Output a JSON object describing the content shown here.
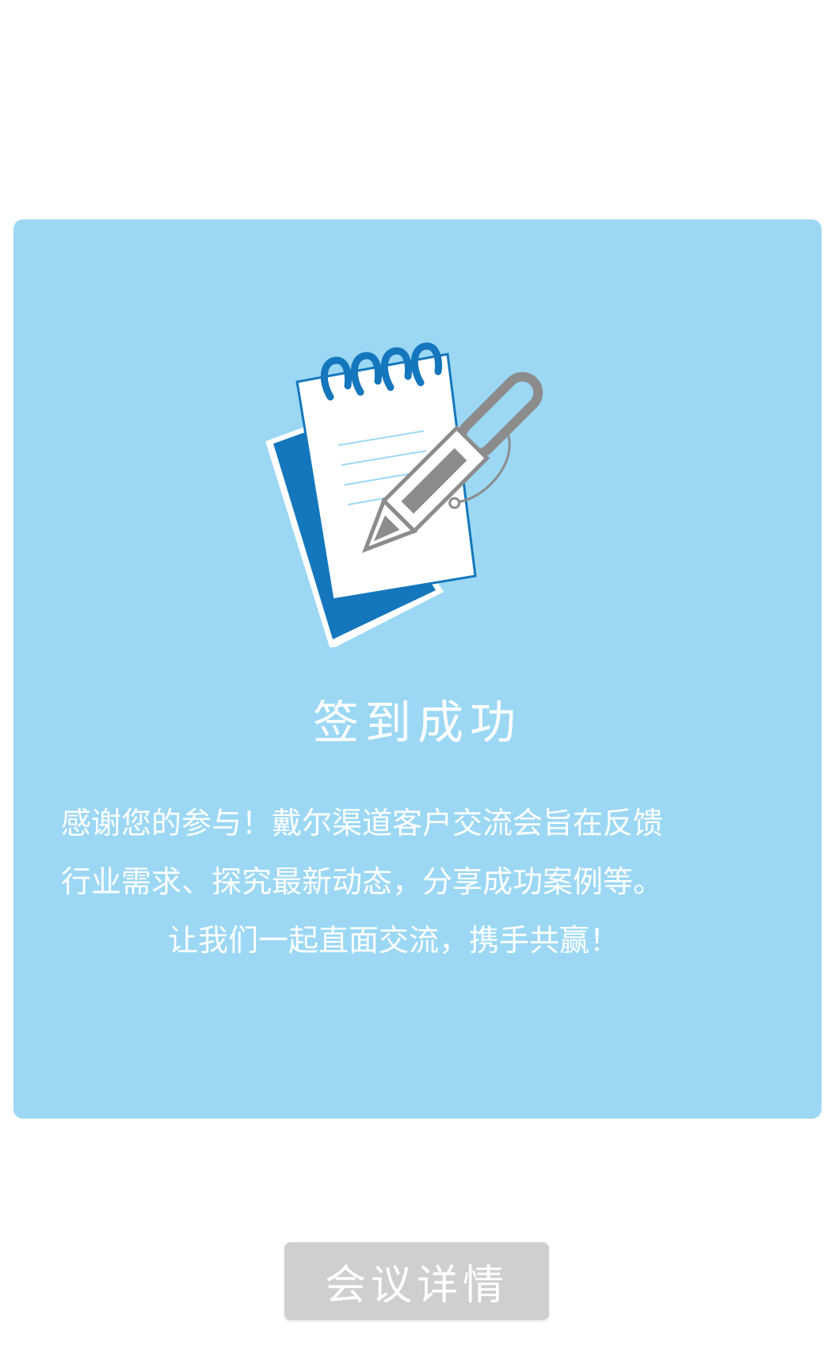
{
  "card": {
    "title": "签到成功",
    "message_lines": [
      "感谢您的参与！戴尔渠道客户交流会旨在反馈",
      "行业需求、探究最新动态，分享成功案例等。",
      "让我们一起直面交流，携手共赢！"
    ],
    "illustration_icon": "notepad-with-pen-icon"
  },
  "button": {
    "label": "会议详情"
  },
  "colors": {
    "card_background": "#9cd8f4",
    "accent_blue": "#1477bd",
    "button_background": "#cfcfcf",
    "text": "#ffffff"
  }
}
